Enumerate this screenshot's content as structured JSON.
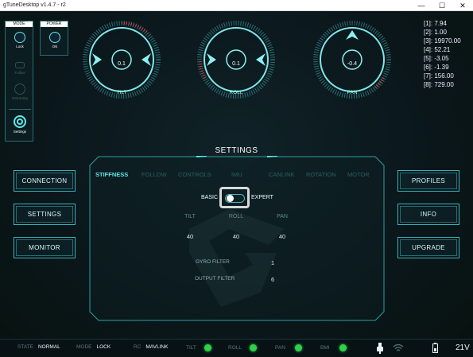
{
  "window": {
    "title": "gTuneDesktop  v1.4.7 - r2",
    "minimize": "—",
    "maximize": "☐",
    "close": "✕"
  },
  "mode_panel": {
    "header": "MODE",
    "items": [
      {
        "label": "Lock"
      },
      {
        "label": "Follow"
      },
      {
        "label": "Returning"
      },
      {
        "label": "Settings"
      }
    ]
  },
  "power_panel": {
    "header": "POWER",
    "label": "ON"
  },
  "dials": [
    {
      "label": "TILT",
      "value": "0.1"
    },
    {
      "label": "ROLL",
      "value": "0.1"
    },
    {
      "label": "PAN",
      "value": "-0.4"
    }
  ],
  "readouts": [
    "[1]: 7.94",
    "[2]: 1.00",
    "[3]: 19970.00",
    "[4]: 52.21",
    "[5]: -3.05",
    "[6]: -1.39",
    "[7]: 156.00",
    "[8]: 729.00"
  ],
  "settings": {
    "title": "SETTINGS",
    "tabs": [
      "STIFFNESS",
      "FOLLOW",
      "CONTROLS",
      "IMU",
      "CANLINK",
      "ROTATION",
      "MOTOR"
    ],
    "active_tab": "STIFFNESS",
    "toggle": {
      "left": "BASIC",
      "right": "EXPERT",
      "state": "basic"
    },
    "columns": [
      {
        "header": "TILT",
        "value": "40"
      },
      {
        "header": "ROLL",
        "value": "40"
      },
      {
        "header": "PAN",
        "value": "40"
      }
    ],
    "gyro_filter": {
      "label": "GYRO FILTER",
      "value": "1"
    },
    "output_filter": {
      "label": "OUTPUT FILTER",
      "value": "6"
    }
  },
  "left_buttons": [
    "CONNECTION",
    "SETTINGS",
    "MONITOR"
  ],
  "right_buttons": [
    "PROFILES",
    "INFO",
    "UPGRADE"
  ],
  "statusbar": {
    "state_label": "STATE",
    "state_value": "NORMAL",
    "mode_label": "MODE",
    "mode_value": "LOCK",
    "rc_label": "RC",
    "rc_value": "MAVLINK",
    "indicators": [
      "TILT",
      "ROLL",
      "PAN",
      "BMI"
    ],
    "indicator_color": "#2fd04a",
    "voltage": "21V"
  },
  "colors": {
    "accent": "#5ee7e9",
    "frame": "#3ab3b8",
    "background": "#0a1418"
  }
}
